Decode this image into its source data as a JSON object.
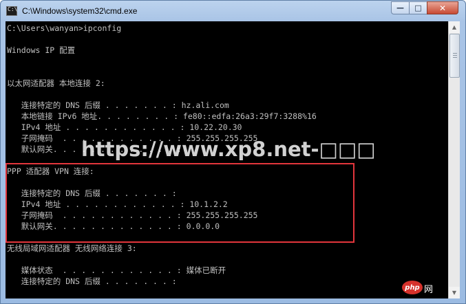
{
  "window": {
    "title": "C:\\Windows\\system32\\cmd.exe",
    "icon": "cmd-icon",
    "icon_glyph": "C:\\",
    "controls": {
      "minimize": "—",
      "maximize": "□",
      "close": "✕"
    }
  },
  "console": {
    "lines": [
      "C:\\Users\\wanyan>ipconfig",
      "",
      "Windows IP 配置",
      "",
      "",
      "以太网适配器 本地连接 2:",
      "",
      "   连接特定的 DNS 后缀 . . . . . . . : hz.ali.com",
      "   本地链接 IPv6 地址. . . . . . . . : fe80::edfa:26a3:29f7:3288%16",
      "   IPv4 地址 . . . . . . . . . . . . : 10.22.20.30",
      "   子网掩码  . . . . . . . . . . . . : 255.255.255.255",
      "   默认网关. . . . . . . . . . . . . :",
      "",
      "PPP 适配器 VPN 连接:",
      "",
      "   连接特定的 DNS 后缀 . . . . . . . :",
      "   IPv4 地址 . . . . . . . . . . . . : 10.1.2.2",
      "   子网掩码  . . . . . . . . . . . . : 255.255.255.255",
      "   默认网关. . . . . . . . . . . . . : 0.0.0.0",
      "",
      "无线局域网适配器 无线网络连接 3:",
      "",
      "   媒体状态  . . . . . . . . . . . . : 媒体已断开",
      "   连接特定的 DNS 后缀 . . . . . . . :"
    ]
  },
  "overlay": {
    "watermark": "https://www.xp8.net-□□□",
    "highlight_color": "#e3363c",
    "badge_text": "php",
    "badge_suffix": "网"
  },
  "colors": {
    "console_bg": "#000000",
    "console_fg": "#c0c0c0",
    "titlebar": "#a9c4e6"
  }
}
